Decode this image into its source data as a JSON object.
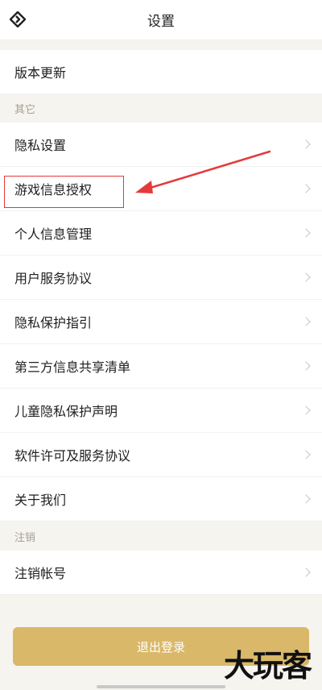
{
  "header": {
    "title": "设置"
  },
  "version_row": {
    "label": "版本更新"
  },
  "sections": {
    "other_title": "其它",
    "cancel_title": "注销"
  },
  "other_items": [
    {
      "label": "隐私设置"
    },
    {
      "label": "游戏信息授权"
    },
    {
      "label": "个人信息管理"
    },
    {
      "label": "用户服务协议"
    },
    {
      "label": "隐私保护指引"
    },
    {
      "label": "第三方信息共享清单"
    },
    {
      "label": "儿童隐私保护声明"
    },
    {
      "label": "软件许可及服务协议"
    },
    {
      "label": "关于我们"
    }
  ],
  "cancel_items": [
    {
      "label": "注销帐号"
    }
  ],
  "logout": {
    "label": "退出登录"
  },
  "watermark": {
    "text": "大玩客"
  },
  "colors": {
    "accent": "#d9b869",
    "annotation": "#e53a3a",
    "section_text": "#a59e92",
    "background": "#f6f4ef"
  }
}
